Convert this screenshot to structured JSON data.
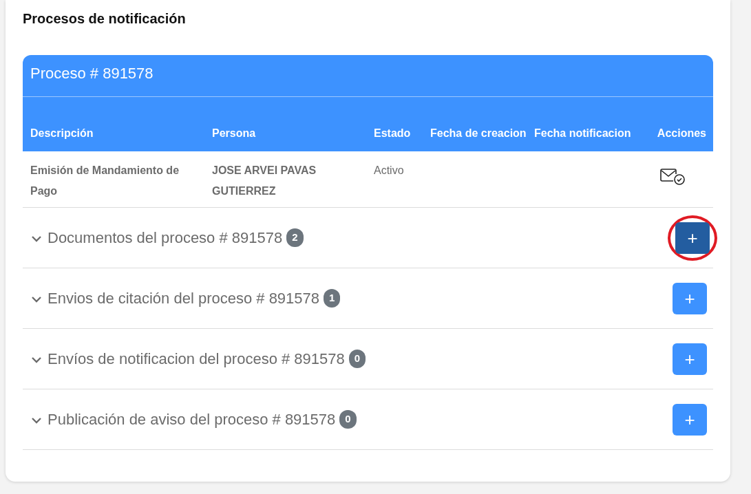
{
  "title": "Procesos de notificación",
  "process": {
    "title": "Proceso # 891578",
    "columns": [
      "Descripción",
      "Persona",
      "Estado",
      "Fecha de creacion",
      "Fecha notificacion",
      "Acciones"
    ],
    "rows": [
      {
        "description": "Emisión de Mandamiento de Pago",
        "person": "JOSE ARVEI PAVAS GUTIERREZ",
        "status": "Activo"
      }
    ]
  },
  "sections": [
    {
      "label": "Documentos del proceso # 891578",
      "count": "2",
      "button_label": "+",
      "expanded": false,
      "active": true,
      "highlighted": true
    },
    {
      "label": "Envios de citación del proceso # 891578",
      "count": "1",
      "button_label": "+",
      "expanded": false,
      "active": false,
      "highlighted": false
    },
    {
      "label": "Envíos de notificacion del proceso # 891578",
      "count": "0",
      "button_label": "+",
      "expanded": false,
      "active": false,
      "highlighted": false
    },
    {
      "label": "Publicación de aviso del proceso # 891578",
      "count": "0",
      "button_label": "+",
      "expanded": false,
      "active": false,
      "highlighted": false
    }
  ]
}
